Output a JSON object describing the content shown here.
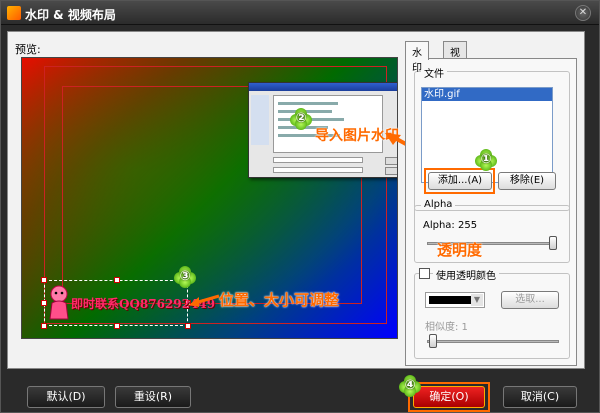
{
  "window": {
    "title": "水印 & 视频布局",
    "close_glyph": "✕"
  },
  "preview": {
    "label": "预览:",
    "watermark_text": "即时联系QQ876292449"
  },
  "tabs": [
    {
      "label": "水印",
      "active": true
    },
    {
      "label": "视频布局",
      "active": false
    }
  ],
  "file_group": {
    "label": "文件",
    "files": [
      "水印.gif"
    ],
    "add_button": "添加...(A)",
    "remove_button": "移除(E)"
  },
  "alpha_group": {
    "label": "Alpha",
    "value_text": "Alpha: 255",
    "alpha_value": 255
  },
  "transparent_group": {
    "checkbox_label": "使用透明颜色",
    "checked": false,
    "color": "#000000",
    "pick_button": "选取...",
    "similarity_text": "相似度: 1"
  },
  "annotations": {
    "import_text": "导入图片水印",
    "opacity_text": "透明度",
    "position_text": "位置、大小可调整",
    "markers": [
      "①",
      "②",
      "③",
      "④"
    ]
  },
  "footer": {
    "default_button": "默认(D)",
    "reset_button": "重设(R)",
    "ok_button": "确定(O)",
    "cancel_button": "取消(C)"
  },
  "colors": {
    "accent": "#ff6a00",
    "highlight": "#ff6a00",
    "selection": "#316ac5"
  },
  "icons": {
    "close": "close-icon",
    "app": "app-icon"
  }
}
